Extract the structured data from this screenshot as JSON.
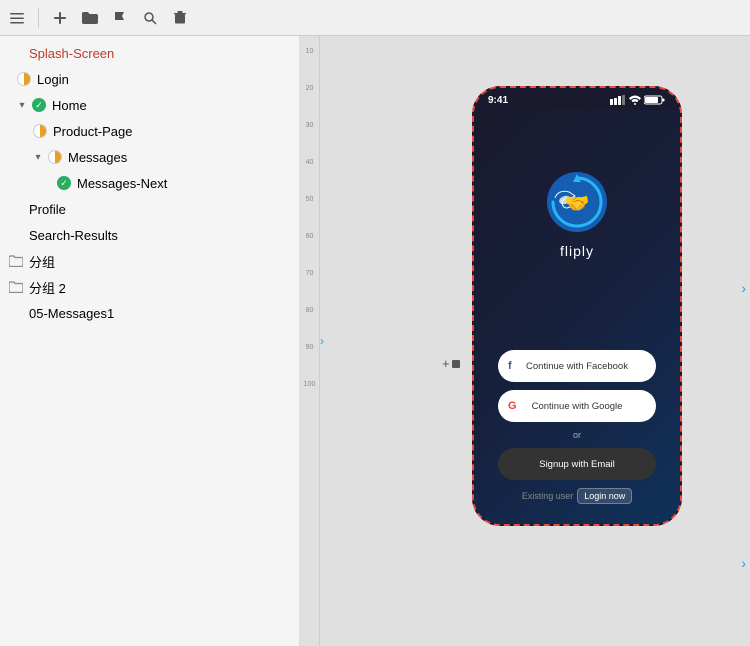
{
  "toolbar": {
    "icons": [
      "plus",
      "folder",
      "flag",
      "search",
      "trash"
    ]
  },
  "sidebar": {
    "items": [
      {
        "id": "splash-screen",
        "label": "Splash-Screen",
        "indent": 0,
        "type": "active",
        "hasChevron": false,
        "iconType": "none"
      },
      {
        "id": "login",
        "label": "Login",
        "indent": 1,
        "type": "half-orange",
        "hasChevron": false,
        "iconType": "half-orange"
      },
      {
        "id": "home",
        "label": "Home",
        "indent": 1,
        "type": "green-check",
        "hasChevron": true,
        "chevronOpen": true,
        "iconType": "green-check"
      },
      {
        "id": "product-page",
        "label": "Product-Page",
        "indent": 2,
        "type": "half-orange",
        "hasChevron": false,
        "iconType": "half-orange"
      },
      {
        "id": "messages",
        "label": "Messages",
        "indent": 2,
        "type": "half-orange",
        "hasChevron": true,
        "chevronOpen": true,
        "iconType": "half-orange"
      },
      {
        "id": "messages-next",
        "label": "Messages-Next",
        "indent": 3,
        "type": "green-check",
        "hasChevron": false,
        "iconType": "green-check"
      },
      {
        "id": "profile",
        "label": "Profile",
        "indent": 0,
        "type": "none",
        "hasChevron": false,
        "iconType": "none"
      },
      {
        "id": "search-results",
        "label": "Search-Results",
        "indent": 0,
        "type": "none",
        "hasChevron": false,
        "iconType": "none"
      },
      {
        "id": "group1",
        "label": "分组",
        "indent": 0,
        "type": "folder",
        "hasChevron": false,
        "iconType": "folder"
      },
      {
        "id": "group2",
        "label": "分组 2",
        "indent": 0,
        "type": "folder",
        "hasChevron": false,
        "iconType": "folder"
      },
      {
        "id": "messages1",
        "label": "05-Messages1",
        "indent": 0,
        "type": "none",
        "hasChevron": false,
        "iconType": "none"
      }
    ]
  },
  "phone": {
    "time": "9:41",
    "signal": "▌▌▌",
    "wifi": "⊙",
    "battery": "▓▓",
    "app_name": "fliply",
    "buttons": {
      "facebook": "f  Continue with Facebook",
      "google": "G  Continue with Google",
      "or": "or",
      "email": "Signup with Email",
      "existing": "Existing user",
      "login_now": "Login now"
    }
  },
  "ruler": {
    "marks": [
      "10",
      "20",
      "30",
      "40",
      "50",
      "60",
      "70",
      "80",
      "90",
      "100"
    ]
  }
}
